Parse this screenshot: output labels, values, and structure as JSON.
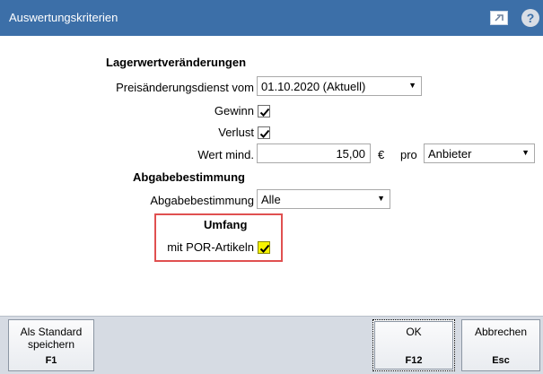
{
  "window": {
    "title": "Auswertungskriterien",
    "icons": [
      "window-mode-icon",
      "help-icon"
    ],
    "help_glyph": "?"
  },
  "sections": {
    "lager": {
      "heading": "Lagerwertveränderungen",
      "preis_label": "Preisänderungsdienst vom",
      "preis_value": "01.10.2020 (Aktuell)",
      "gewinn_label": "Gewinn",
      "gewinn_checked": true,
      "verlust_label": "Verlust",
      "verlust_checked": true,
      "wert_label": "Wert mind.",
      "wert_value": "15,00",
      "currency": "€",
      "pro_label": "pro",
      "pro_value": "Anbieter"
    },
    "abgabe": {
      "heading": "Abgabebestimmung",
      "label": "Abgabebestimmung",
      "value": "Alle"
    },
    "umfang": {
      "heading": "Umfang",
      "por_label": "mit POR-Artikeln",
      "por_checked": true,
      "highlight_color": "#e05050"
    }
  },
  "footer": {
    "standard": {
      "line1": "Als Standard",
      "line2": "speichern",
      "key": "F1"
    },
    "ok": {
      "label": "OK",
      "key": "F12"
    },
    "cancel": {
      "label": "Abbrechen",
      "key": "Esc"
    }
  },
  "colors": {
    "titlebar": "#3c6fa8",
    "footer": "#d6dbe3",
    "checkbox_highlight": "#f6f300"
  }
}
